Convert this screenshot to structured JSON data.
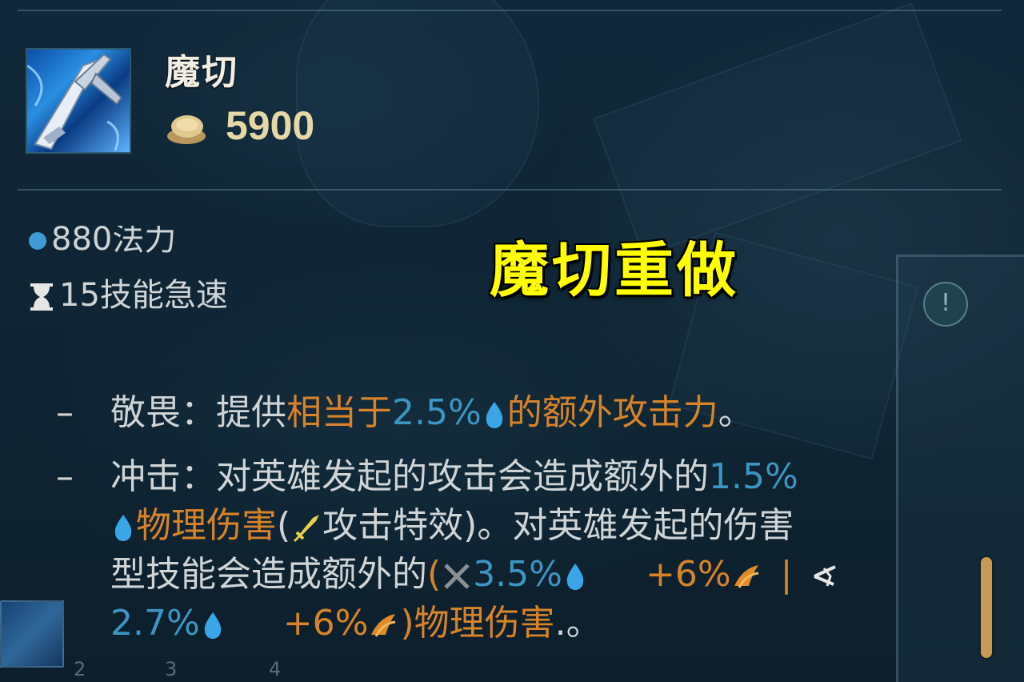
{
  "item": {
    "name": "魔切",
    "price": "5900"
  },
  "overlay": {
    "title": "魔切重做"
  },
  "stats": {
    "ability_power": "880法力",
    "ability_haste": "15技能急速"
  },
  "passives": {
    "dash": "–",
    "awe": {
      "label": "敬畏：提供",
      "equiv": "相当于",
      "percent": "2.5%",
      "rest": "的额外攻击力",
      "end": "。"
    },
    "shock": {
      "label": "冲击：对英雄发起的攻击会造成额外的",
      "percent": "1.5%",
      "dmg_type": "物理伤害",
      "paren_open": "(",
      "on_hit": "攻击特效",
      "paren_close": ")。对英雄发起的伤害",
      "line3_start": "型技能会造成额外的",
      "melee_open": "(",
      "melee_percent": "3.5%",
      "melee_bonus": "+6%",
      "separator": "|",
      "ranged_percent": "2.7%",
      "ranged_bonus": "+6%",
      "ranged_close": ")",
      "dmg_type2": "物理伤害",
      "end": ".。"
    }
  },
  "hud": {
    "ping_symbol": "!",
    "slots": [
      "2",
      "3",
      "4"
    ]
  },
  "colors": {
    "orange": "#d7832a",
    "blue": "#3c95c2",
    "title_yellow": "#ffff00",
    "gold_text": "#e6d7a6"
  }
}
